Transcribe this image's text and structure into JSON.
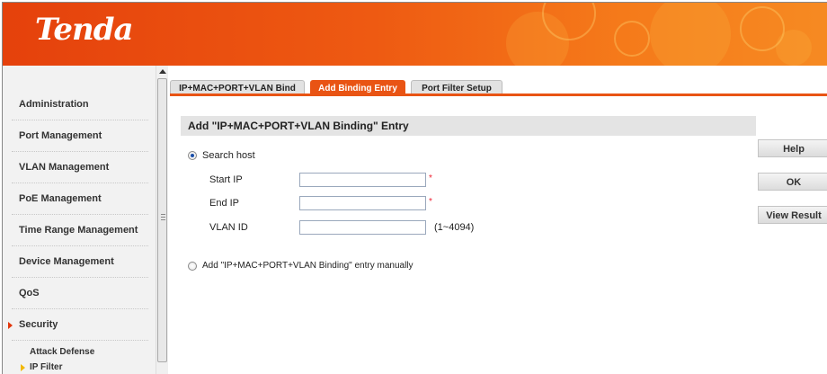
{
  "header": {
    "logo": "Tenda"
  },
  "sidebar": {
    "items": [
      {
        "label": "Administration"
      },
      {
        "label": "Port Management"
      },
      {
        "label": "VLAN Management"
      },
      {
        "label": "PoE Management"
      },
      {
        "label": "Time Range Management"
      },
      {
        "label": "Device Management"
      },
      {
        "label": "QoS"
      },
      {
        "label": "Security",
        "expanded": true
      }
    ],
    "subitems": [
      {
        "label": "Attack Defense"
      },
      {
        "label": "IP Filter",
        "selected": true
      }
    ]
  },
  "tabs": [
    {
      "label": "IP+MAC+PORT+VLAN Bind"
    },
    {
      "label": "Add Binding Entry",
      "active": true
    },
    {
      "label": "Port Filter Setup"
    }
  ],
  "section": {
    "title": "Add \"IP+MAC+PORT+VLAN Binding\" Entry"
  },
  "form": {
    "search_host_label": "Search host",
    "search_host_selected": true,
    "start_ip_label": "Start IP",
    "start_ip_value": "",
    "end_ip_label": "End IP",
    "end_ip_value": "",
    "vlan_id_label": "VLAN ID",
    "vlan_id_value": "",
    "vlan_id_hint": "(1~4094)",
    "required_mark": "*",
    "manual_label": "Add \"IP+MAC+PORT+VLAN Binding\" entry manually",
    "manual_selected": false
  },
  "buttons": {
    "help": "Help",
    "ok": "OK",
    "view_result": "View Result"
  },
  "colors": {
    "accent": "#e95414",
    "header_start": "#e5410c",
    "header_end": "#f68a22",
    "sub_arrow": "#f2b800"
  }
}
